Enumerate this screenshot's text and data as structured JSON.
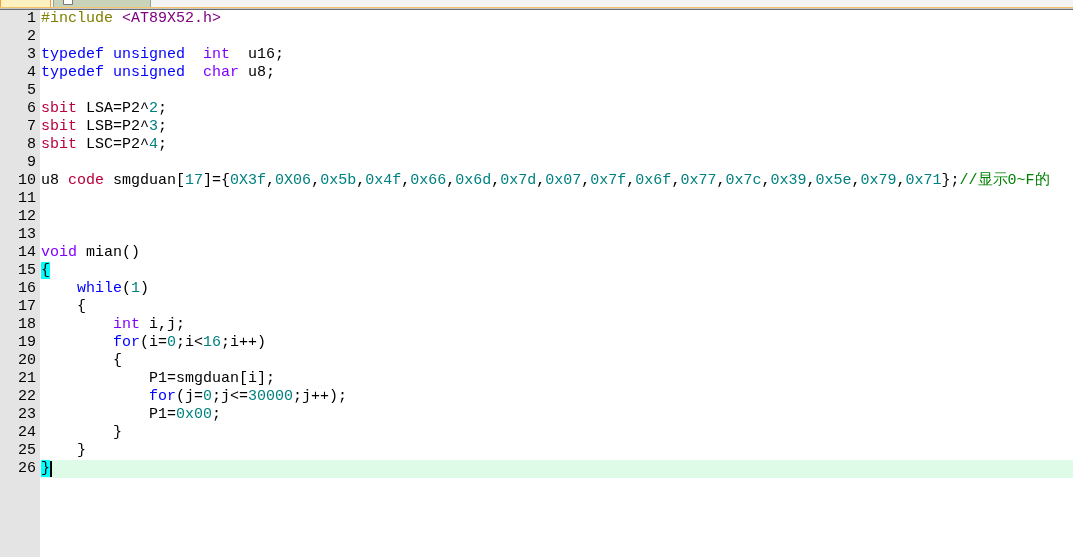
{
  "tabs": [
    {
      "selected": true
    },
    {
      "selected": false,
      "icon": true
    }
  ],
  "editor": {
    "lines": [
      {
        "number": "1",
        "current": false,
        "tokens": [
          {
            "text": "#include",
            "kind": "preprocessor"
          },
          {
            "text": " <AT89X52.h>",
            "kind": "include_path"
          }
        ]
      },
      {
        "number": "2",
        "current": false
      },
      {
        "number": "3",
        "current": false,
        "tokens": [
          {
            "text": "typedef",
            "kind": "keyword"
          },
          {
            "text": " unsigned",
            "kind": "keyword"
          },
          {
            "text": "  int",
            "kind": "type"
          },
          {
            "text": "  u16;",
            "kind": "plain"
          }
        ]
      },
      {
        "number": "4",
        "current": false,
        "tokens": [
          {
            "text": "typedef",
            "kind": "keyword"
          },
          {
            "text": " unsigned",
            "kind": "keyword"
          },
          {
            "text": "  char",
            "kind": "type"
          },
          {
            "text": " u8;",
            "kind": "plain"
          }
        ]
      },
      {
        "number": "5",
        "current": false
      },
      {
        "number": "6",
        "current": false,
        "tokens": [
          {
            "text": "sbit",
            "kind": "special"
          },
          {
            "text": " LSA=P2^",
            "kind": "plain"
          },
          {
            "text": "2",
            "kind": "number"
          },
          {
            "text": ";",
            "kind": "plain"
          }
        ]
      },
      {
        "number": "7",
        "current": false,
        "tokens": [
          {
            "text": "sbit",
            "kind": "special"
          },
          {
            "text": " LSB=P2^",
            "kind": "plain"
          },
          {
            "text": "3",
            "kind": "number"
          },
          {
            "text": ";",
            "kind": "plain"
          }
        ]
      },
      {
        "number": "8",
        "current": false,
        "tokens": [
          {
            "text": "sbit",
            "kind": "special"
          },
          {
            "text": " LSC=P2^",
            "kind": "plain"
          },
          {
            "text": "4",
            "kind": "number"
          },
          {
            "text": ";",
            "kind": "plain"
          }
        ]
      },
      {
        "number": "9",
        "current": false
      },
      {
        "number": "10",
        "current": false,
        "tokens": [
          {
            "text": "u8",
            "kind": "plain"
          },
          {
            "text": " code",
            "kind": "special"
          },
          {
            "text": " smgduan[",
            "kind": "plain"
          },
          {
            "text": "17",
            "kind": "number"
          },
          {
            "text": "]={",
            "kind": "plain"
          },
          {
            "text": "0X3f",
            "kind": "number"
          },
          {
            "text": ",",
            "kind": "plain"
          },
          {
            "text": "0X06",
            "kind": "number"
          },
          {
            "text": ",",
            "kind": "plain"
          },
          {
            "text": "0x5b",
            "kind": "number"
          },
          {
            "text": ",",
            "kind": "plain"
          },
          {
            "text": "0x4f",
            "kind": "number"
          },
          {
            "text": ",",
            "kind": "plain"
          },
          {
            "text": "0x66",
            "kind": "number"
          },
          {
            "text": ",",
            "kind": "plain"
          },
          {
            "text": "0x6d",
            "kind": "number"
          },
          {
            "text": ",",
            "kind": "plain"
          },
          {
            "text": "0x7d",
            "kind": "number"
          },
          {
            "text": ",",
            "kind": "plain"
          },
          {
            "text": "0x07",
            "kind": "number"
          },
          {
            "text": ",",
            "kind": "plain"
          },
          {
            "text": "0x7f",
            "kind": "number"
          },
          {
            "text": ",",
            "kind": "plain"
          },
          {
            "text": "0x6f",
            "kind": "number"
          },
          {
            "text": ",",
            "kind": "plain"
          },
          {
            "text": "0x77",
            "kind": "number"
          },
          {
            "text": ",",
            "kind": "plain"
          },
          {
            "text": "0x7c",
            "kind": "number"
          },
          {
            "text": ",",
            "kind": "plain"
          },
          {
            "text": "0x39",
            "kind": "number"
          },
          {
            "text": ",",
            "kind": "plain"
          },
          {
            "text": "0x5e",
            "kind": "number"
          },
          {
            "text": ",",
            "kind": "plain"
          },
          {
            "text": "0x79",
            "kind": "number"
          },
          {
            "text": ",",
            "kind": "plain"
          },
          {
            "text": "0x71",
            "kind": "number"
          },
          {
            "text": "};",
            "kind": "plain"
          },
          {
            "text": "//显示0~F的",
            "kind": "comment"
          }
        ]
      },
      {
        "number": "11",
        "current": false
      },
      {
        "number": "12",
        "current": false
      },
      {
        "number": "13",
        "current": false
      },
      {
        "number": "14",
        "current": false,
        "tokens": [
          {
            "text": "void",
            "kind": "type"
          },
          {
            "text": " mian()",
            "kind": "plain"
          }
        ]
      },
      {
        "number": "15",
        "current": false,
        "tokens": [
          {
            "text": "{",
            "kind": "brace_match"
          }
        ]
      },
      {
        "number": "16",
        "current": false,
        "tokens": [
          {
            "text": "    while",
            "kind": "keyword"
          },
          {
            "text": "(",
            "kind": "plain"
          },
          {
            "text": "1",
            "kind": "number"
          },
          {
            "text": ")",
            "kind": "plain"
          }
        ]
      },
      {
        "number": "17",
        "current": false,
        "tokens": [
          {
            "text": "    {",
            "kind": "plain"
          }
        ]
      },
      {
        "number": "18",
        "current": false,
        "tokens": [
          {
            "text": "        int",
            "kind": "type"
          },
          {
            "text": " i,j;",
            "kind": "plain"
          }
        ]
      },
      {
        "number": "19",
        "current": false,
        "tokens": [
          {
            "text": "        for",
            "kind": "keyword"
          },
          {
            "text": "(i=",
            "kind": "plain"
          },
          {
            "text": "0",
            "kind": "number"
          },
          {
            "text": ";i<",
            "kind": "plain"
          },
          {
            "text": "16",
            "kind": "number"
          },
          {
            "text": ";i++)",
            "kind": "plain"
          }
        ]
      },
      {
        "number": "20",
        "current": false,
        "tokens": [
          {
            "text": "        {",
            "kind": "plain"
          }
        ]
      },
      {
        "number": "21",
        "current": false,
        "tokens": [
          {
            "text": "            P1=smgduan[i];",
            "kind": "plain"
          }
        ]
      },
      {
        "number": "22",
        "current": false,
        "tokens": [
          {
            "text": "            for",
            "kind": "keyword"
          },
          {
            "text": "(j=",
            "kind": "plain"
          },
          {
            "text": "0",
            "kind": "number"
          },
          {
            "text": ";j<=",
            "kind": "plain"
          },
          {
            "text": "30000",
            "kind": "number"
          },
          {
            "text": ";j++);",
            "kind": "plain"
          }
        ]
      },
      {
        "number": "23",
        "current": false,
        "tokens": [
          {
            "text": "            P1=",
            "kind": "plain"
          },
          {
            "text": "0x00",
            "kind": "number"
          },
          {
            "text": ";",
            "kind": "plain"
          }
        ]
      },
      {
        "number": "24",
        "current": false,
        "tokens": [
          {
            "text": "        }",
            "kind": "plain"
          }
        ]
      },
      {
        "number": "25",
        "current": false,
        "tokens": [
          {
            "text": "    }",
            "kind": "plain"
          }
        ]
      },
      {
        "number": "26",
        "current": true,
        "tokens": [
          {
            "text": "}",
            "kind": "brace_match"
          }
        ]
      }
    ]
  }
}
